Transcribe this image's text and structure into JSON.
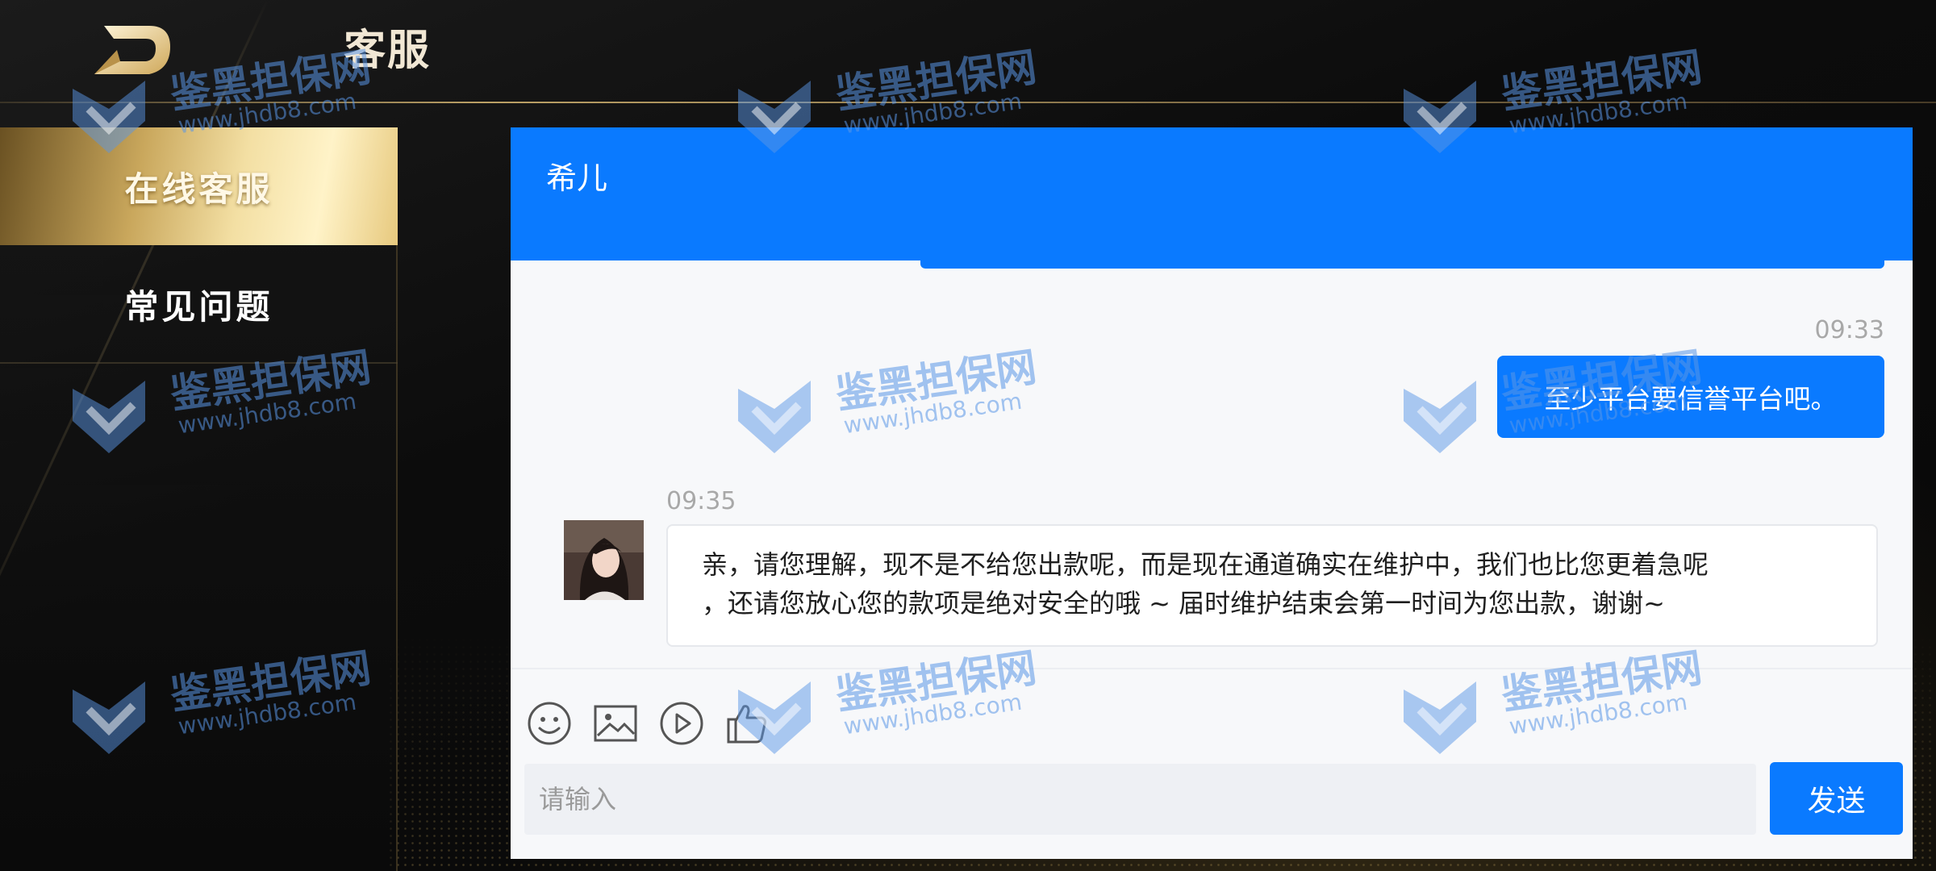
{
  "header": {
    "title": "客服"
  },
  "sidebar": {
    "items": [
      {
        "label": "在线客服",
        "active": true
      },
      {
        "label": "常见问题",
        "active": false
      }
    ]
  },
  "chat": {
    "agent_name": "希儿",
    "messages": [
      {
        "side": "right",
        "time": "09:33",
        "text": "至少平台要信誉平台吧。"
      },
      {
        "side": "left",
        "time": "09:35",
        "text_line1": "亲，请您理解，现不是不给您出款呢，而是现在通道确实在维护中，我们也比您更着急呢",
        "text_line2": "，还请您放心您的款项是绝对安全的哦 ~ 届时维护结束会第一时间为您出款，谢谢~"
      }
    ],
    "toolbar": {
      "icons": [
        "emoji-icon",
        "image-icon",
        "video-icon",
        "thumbs-up-icon"
      ]
    },
    "input": {
      "placeholder": "请输入",
      "value": ""
    },
    "send_label": "发送"
  },
  "watermark": {
    "cn": "鉴黑担保网",
    "en": "www.jhdb8.com"
  },
  "colors": {
    "accent": "#0a7aff",
    "gold": "#e7c97e"
  }
}
